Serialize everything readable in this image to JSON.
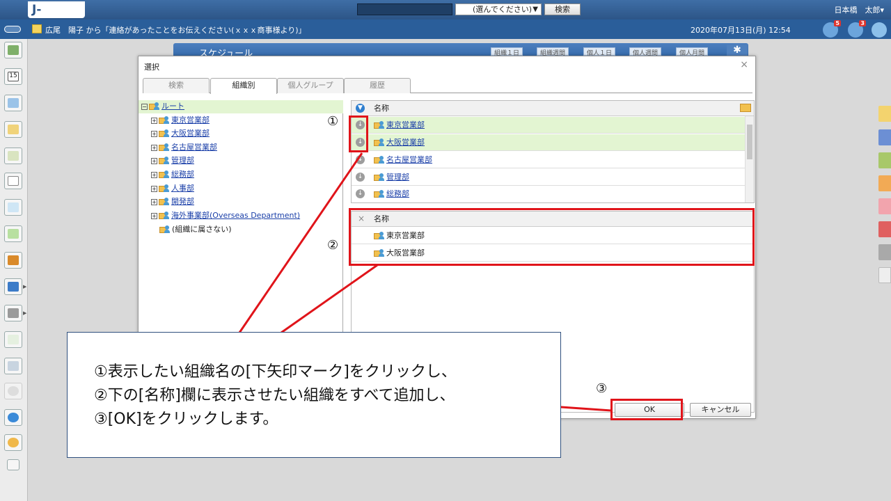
{
  "topbar": {
    "logo": "J-MOTTO",
    "select_value": "(選んでください)",
    "search_button": "検索",
    "user": "日本橋　太郎▾"
  },
  "notification": {
    "text": "広尾　陽子 から「連絡があったことをお伝えください(ｘｘｘ商事様より)」",
    "datetime": "2020年07月13日(月) 12:54",
    "badges": [
      "5",
      "3"
    ]
  },
  "schedule": {
    "title": "スケジュール",
    "tabs": [
      "組織１日",
      "組織週間",
      "個人１日",
      "個人週間",
      "個人月間"
    ]
  },
  "dialog": {
    "title": "選択",
    "close": "×",
    "tabs": [
      "検索",
      "組織別",
      "個人グループ",
      "履歴"
    ],
    "active_tab": "組織別",
    "tree": {
      "root": "ルート",
      "items": [
        "東京営業部",
        "大阪営業部",
        "名古屋営業部",
        "管理部",
        "総務部",
        "人事部",
        "開発部",
        "海外事業部(Overseas Department)"
      ],
      "unassigned": "(組織に属さない)"
    },
    "top_list": {
      "header": "名称",
      "rows": [
        "東京営業部",
        "大阪営業部",
        "名古屋営業部",
        "管理部",
        "総務部"
      ]
    },
    "bottom_list": {
      "header": "名称",
      "rows": [
        "東京営業部",
        "大阪営業部"
      ]
    },
    "ok": "OK",
    "cancel": "キャンセル"
  },
  "annotation": {
    "labels": [
      "①",
      "②",
      "③"
    ],
    "lines": [
      "①表示したい組織名の[下矢印マーク]をクリックし、",
      "②下の[名称]欄に表示させたい組織をすべて追加し、",
      "③[OK]をクリックします。"
    ]
  },
  "colors": {
    "highlight": "#e0141a",
    "selected_row": "#e3f5d2",
    "header_blue": "#2a5e9a"
  }
}
